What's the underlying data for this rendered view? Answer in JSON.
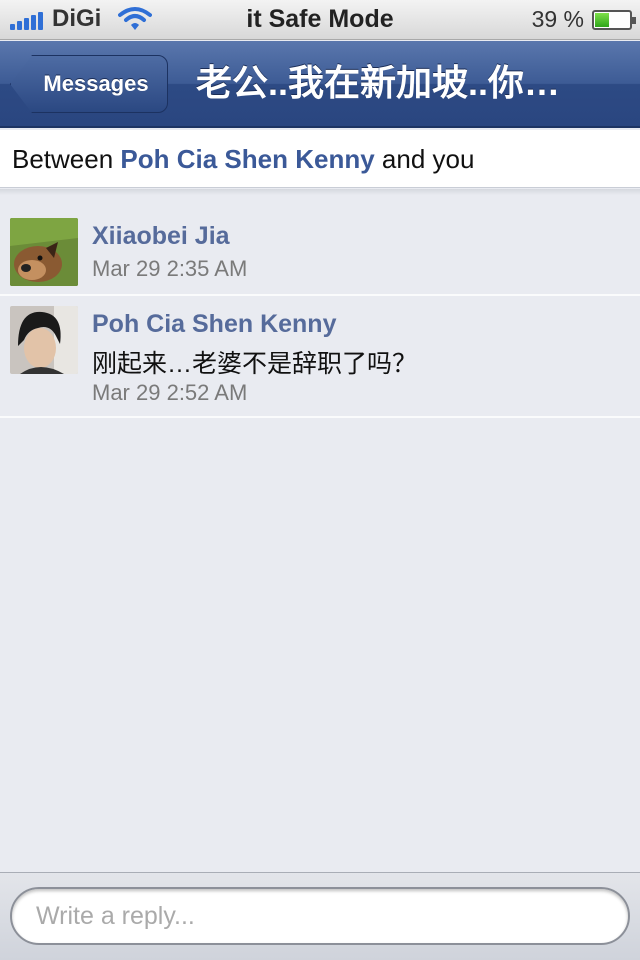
{
  "status_bar": {
    "carrier": "DiGi",
    "title": "it Safe Mode",
    "battery_text": "39 %",
    "battery_level": 0.39,
    "icons": [
      "signal-icon",
      "wifi-icon",
      "battery-icon"
    ]
  },
  "nav": {
    "back_label": "Messages",
    "title": "老公..我在新加坡..你…"
  },
  "between": {
    "prefix": "Between",
    "name": "Poh Cia Shen Kenny",
    "suffix": "and you"
  },
  "messages": [
    {
      "author": "Xiiaobei Jia",
      "text": "",
      "time": "Mar 29 2:35 AM",
      "avatar": "dog-avatar"
    },
    {
      "author": "Poh Cia Shen Kenny",
      "text": "刚起来…老婆不是辞职了吗？",
      "time": "Mar 29 2:52 AM",
      "avatar": "person-avatar"
    }
  ],
  "reply": {
    "placeholder": "Write a reply..."
  },
  "colors": {
    "nav_blue": "#3d5b95",
    "link_blue": "#3b5998",
    "background": "#e9ebf1"
  }
}
